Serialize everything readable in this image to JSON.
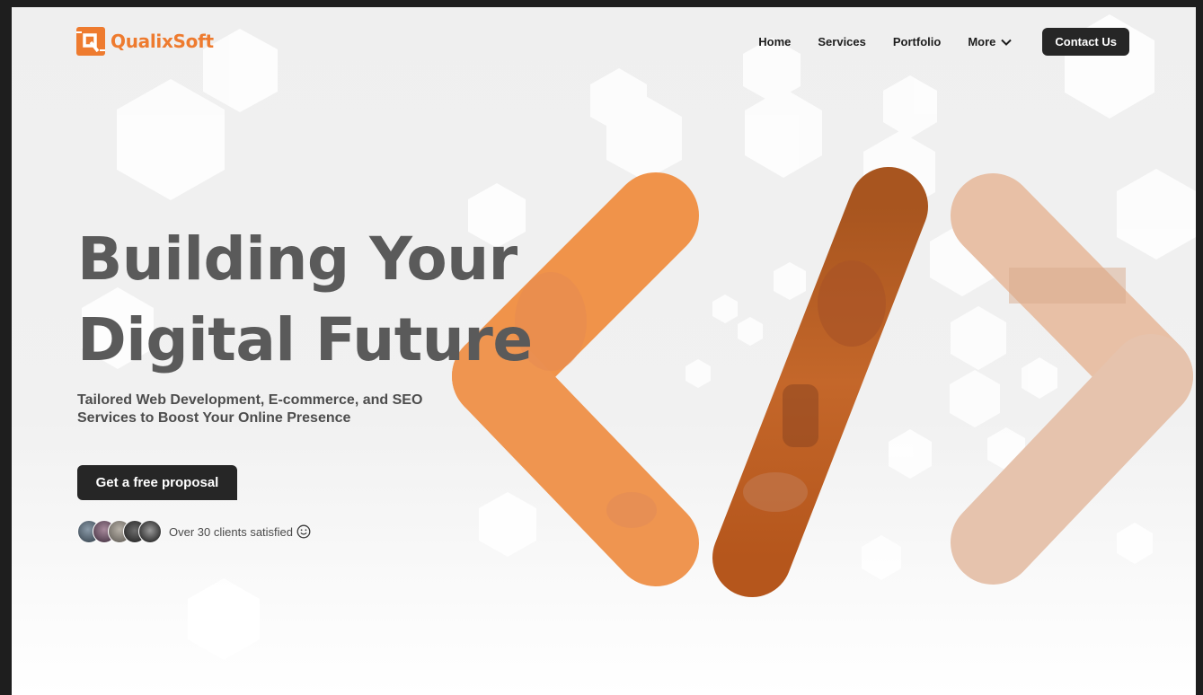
{
  "brand": {
    "name": "QualixSoft",
    "color": "#ee7b2f"
  },
  "nav": {
    "items": [
      "Home",
      "Services",
      "Portfolio"
    ],
    "more_label": "More",
    "contact_label": "Contact Us"
  },
  "hero": {
    "title_line1": "Building Your",
    "title_line2": "Digital Future",
    "subtitle": "Tailored Web Development, E-commerce, and SEO Services to Boost Your Online Presence",
    "cta_label": "Get a free proposal",
    "clients_text": "Over 30 clients satisfied"
  },
  "icons": {
    "logo": "qualixsoft-logo-icon",
    "more": "chevron-down-icon",
    "smile": "smiley-face-icon"
  },
  "colors": {
    "accent": "#ee7b2f",
    "dark_button": "#262626",
    "title_gray": "#5a5a5a"
  }
}
